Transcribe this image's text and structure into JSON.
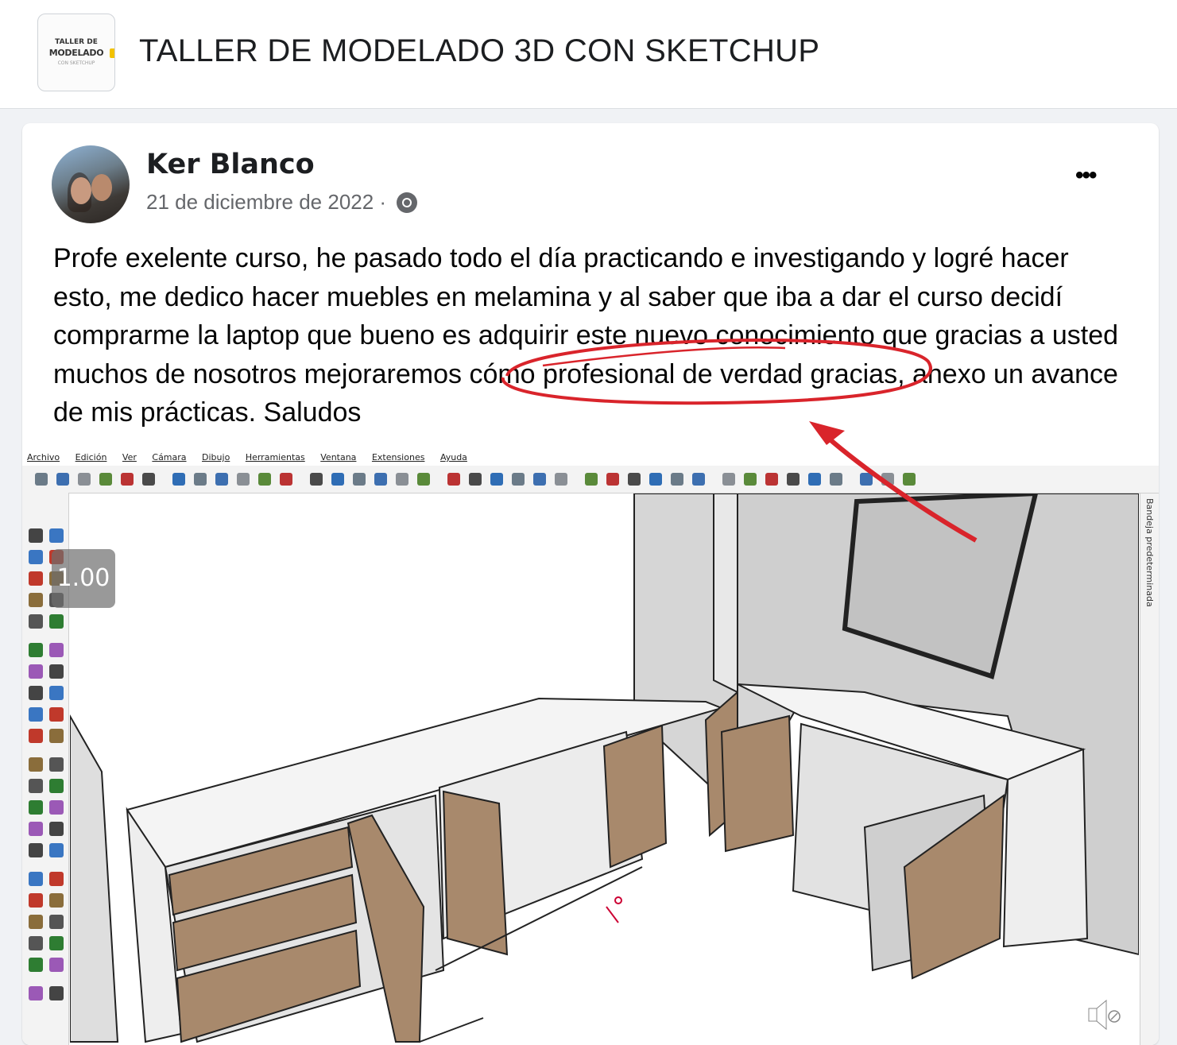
{
  "group": {
    "logo_line1": "TALLER DE",
    "logo_line2": "MODELADO",
    "logo_line3": "CON SKETCHUP",
    "title": "TALLER DE MODELADO 3D CON SKETCHUP"
  },
  "post": {
    "author": "Ker Blanco",
    "date": "21 de diciembre de 2022 ·",
    "audience_icon": "public-group-icon",
    "more_icon": "•••",
    "text": "Profe exelente curso, he pasado todo el día practicando e investigando y logré hacer esto, me dedico hacer muebles en melamina y al saber que iba a dar el curso decidí comprarme la laptop que bueno es adquirir este nuevo conocimiento que gracias a usted muchos de nosotros mejoraremos cómo profesional de verdad gracias, anexo un avance de mis prácticas. Saludos",
    "annotation_color": "#d9242b"
  },
  "sketchup": {
    "menu": [
      "Archivo",
      "Edición",
      "Ver",
      "Cámara",
      "Dibujo",
      "Herramientas",
      "Ventana",
      "Extensiones",
      "Ayuda"
    ],
    "tray_label": "Bandeja predeterminada",
    "speed_badge": "1.00"
  },
  "colors": {
    "wood": "#a8896c",
    "wall": "#d7d7d7",
    "wall_dark": "#c4c4c4",
    "accent_red": "#d9242b"
  }
}
